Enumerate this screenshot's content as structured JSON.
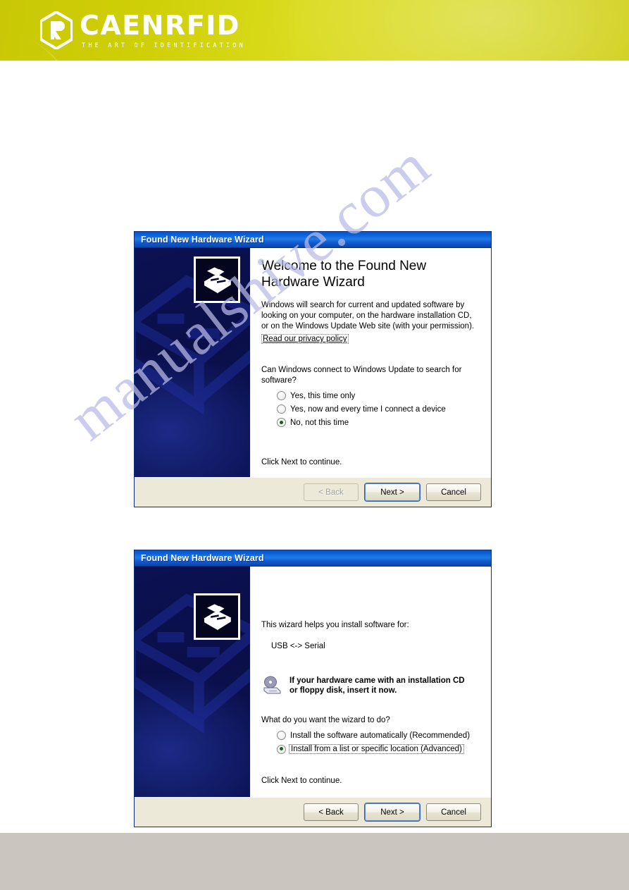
{
  "brand": {
    "logo_word": "CAENRFID",
    "logo_tagline": "THE ART OF IDENTIFICATION",
    "logo_mark": "hexagon-r-icon",
    "accent_color": "#d4d40f"
  },
  "watermark": {
    "text": "manualshive.com",
    "color": "#b9bbe6"
  },
  "footer": {
    "color": "#cbc5c0"
  },
  "dialogs": [
    {
      "id": "found-new-hardware-wizard-welcome",
      "title": "Found New Hardware Wizard",
      "sidebar_icon": "new-hardware-icon",
      "heading": "Welcome to the Found New Hardware Wizard",
      "paragraph": "Windows will search for current and updated software by looking on your computer, on the hardware installation CD, or on the Windows Update Web site (with your permission).",
      "privacy_link": "Read our privacy policy",
      "question": "Can Windows connect to Windows Update to search for software?",
      "options": [
        {
          "label": "Yes, this time only",
          "selected": false,
          "focused": false
        },
        {
          "label": "Yes, now and every time I connect a device",
          "selected": false,
          "focused": false
        },
        {
          "label": "No, not this time",
          "selected": true,
          "focused": false
        }
      ],
      "hint": "Click Next to continue.",
      "buttons": [
        {
          "label": "< Back",
          "state": "disabled"
        },
        {
          "label": "Next >",
          "state": "default"
        },
        {
          "label": "Cancel",
          "state": "normal"
        }
      ]
    },
    {
      "id": "found-new-hardware-wizard-install",
      "title": "Found New Hardware Wizard",
      "sidebar_icon": "new-hardware-icon",
      "intro": "This wizard helps you install software for:",
      "device_name": "USB <-> Serial",
      "cd_icon": "cd-drive-icon",
      "cd_notice_line1": "If your hardware came with an installation CD",
      "cd_notice_line2": "or floppy disk, insert it now.",
      "question": "What do you want the wizard to do?",
      "options": [
        {
          "label": "Install the software automatically (Recommended)",
          "selected": false,
          "focused": false,
          "accel": "I"
        },
        {
          "label": "Install from a list or specific location (Advanced)",
          "selected": true,
          "focused": true,
          "accel": "s"
        }
      ],
      "hint": "Click Next to continue.",
      "buttons": [
        {
          "label": "< Back",
          "state": "normal",
          "accel": "B"
        },
        {
          "label": "Next >",
          "state": "default",
          "accel": "N"
        },
        {
          "label": "Cancel",
          "state": "normal"
        }
      ]
    }
  ]
}
